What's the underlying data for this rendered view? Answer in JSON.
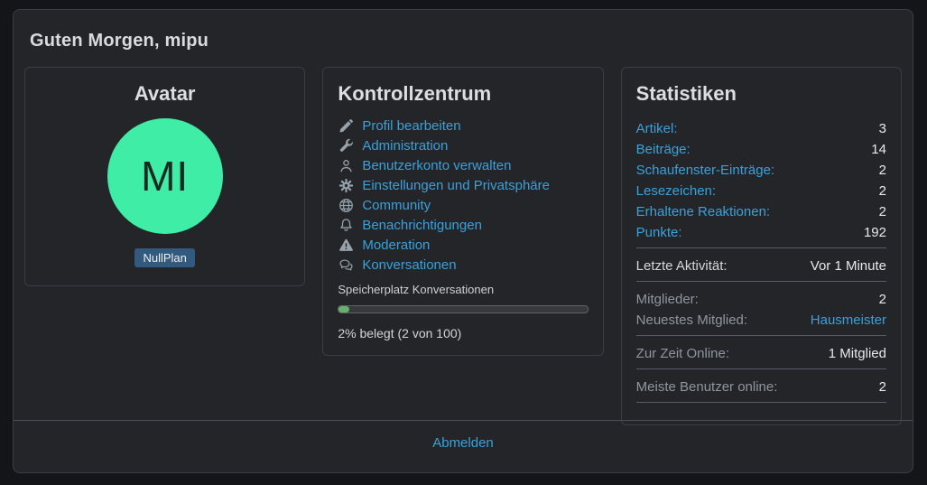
{
  "page": {
    "greeting": "Guten Morgen, mipu"
  },
  "avatar_card": {
    "title": "Avatar",
    "initials": "MI",
    "badge": "NullPlan"
  },
  "control_center": {
    "title": "Kontrollzentrum",
    "links": [
      {
        "icon": "pencil-icon",
        "label": "Profil bearbeiten"
      },
      {
        "icon": "wrench-icon",
        "label": "Administration"
      },
      {
        "icon": "user-icon",
        "label": "Benutzerkonto verwalten"
      },
      {
        "icon": "gear-icon",
        "label": "Einstellungen und Privatsphäre"
      },
      {
        "icon": "globe-icon",
        "label": "Community"
      },
      {
        "icon": "bell-icon",
        "label": "Benachrichtigungen"
      },
      {
        "icon": "warning-triangle-icon",
        "label": "Moderation"
      },
      {
        "icon": "conversations-icon",
        "label": "Konversationen"
      }
    ],
    "storage": {
      "label": "Speicherplatz Konversationen",
      "percent": 2,
      "used": 2,
      "total": 100,
      "status_text": "2% belegt (2 von 100)"
    }
  },
  "statistics": {
    "title": "Statistiken",
    "rows": [
      {
        "label": "Artikel:",
        "value": "3"
      },
      {
        "label": "Beiträge:",
        "value": "14"
      },
      {
        "label": "Schaufenster-Einträge:",
        "value": "2"
      },
      {
        "label": "Lesezeichen:",
        "value": "2"
      },
      {
        "label": "Erhaltene Reaktionen:",
        "value": "2"
      },
      {
        "label": "Punkte:",
        "value": "192"
      },
      {
        "label": "Letzte Aktivität:",
        "value": "Vor 1 Minute"
      },
      {
        "label": "Mitglieder:",
        "value": "2"
      },
      {
        "label": "Neuestes Mitglied:",
        "value": "Hausmeister"
      },
      {
        "label": "Zur Zeit Online:",
        "value": "1 Mitglied"
      },
      {
        "label": "Meiste Benutzer online:",
        "value": "2"
      }
    ]
  },
  "footer": {
    "logout_label": "Abmelden"
  },
  "colors": {
    "accent_link": "#3aa1db",
    "avatar_bg": "#40eda6",
    "badge_bg": "#33597f",
    "progress_fill": "#68b06e",
    "panel_bg": "#232529"
  }
}
